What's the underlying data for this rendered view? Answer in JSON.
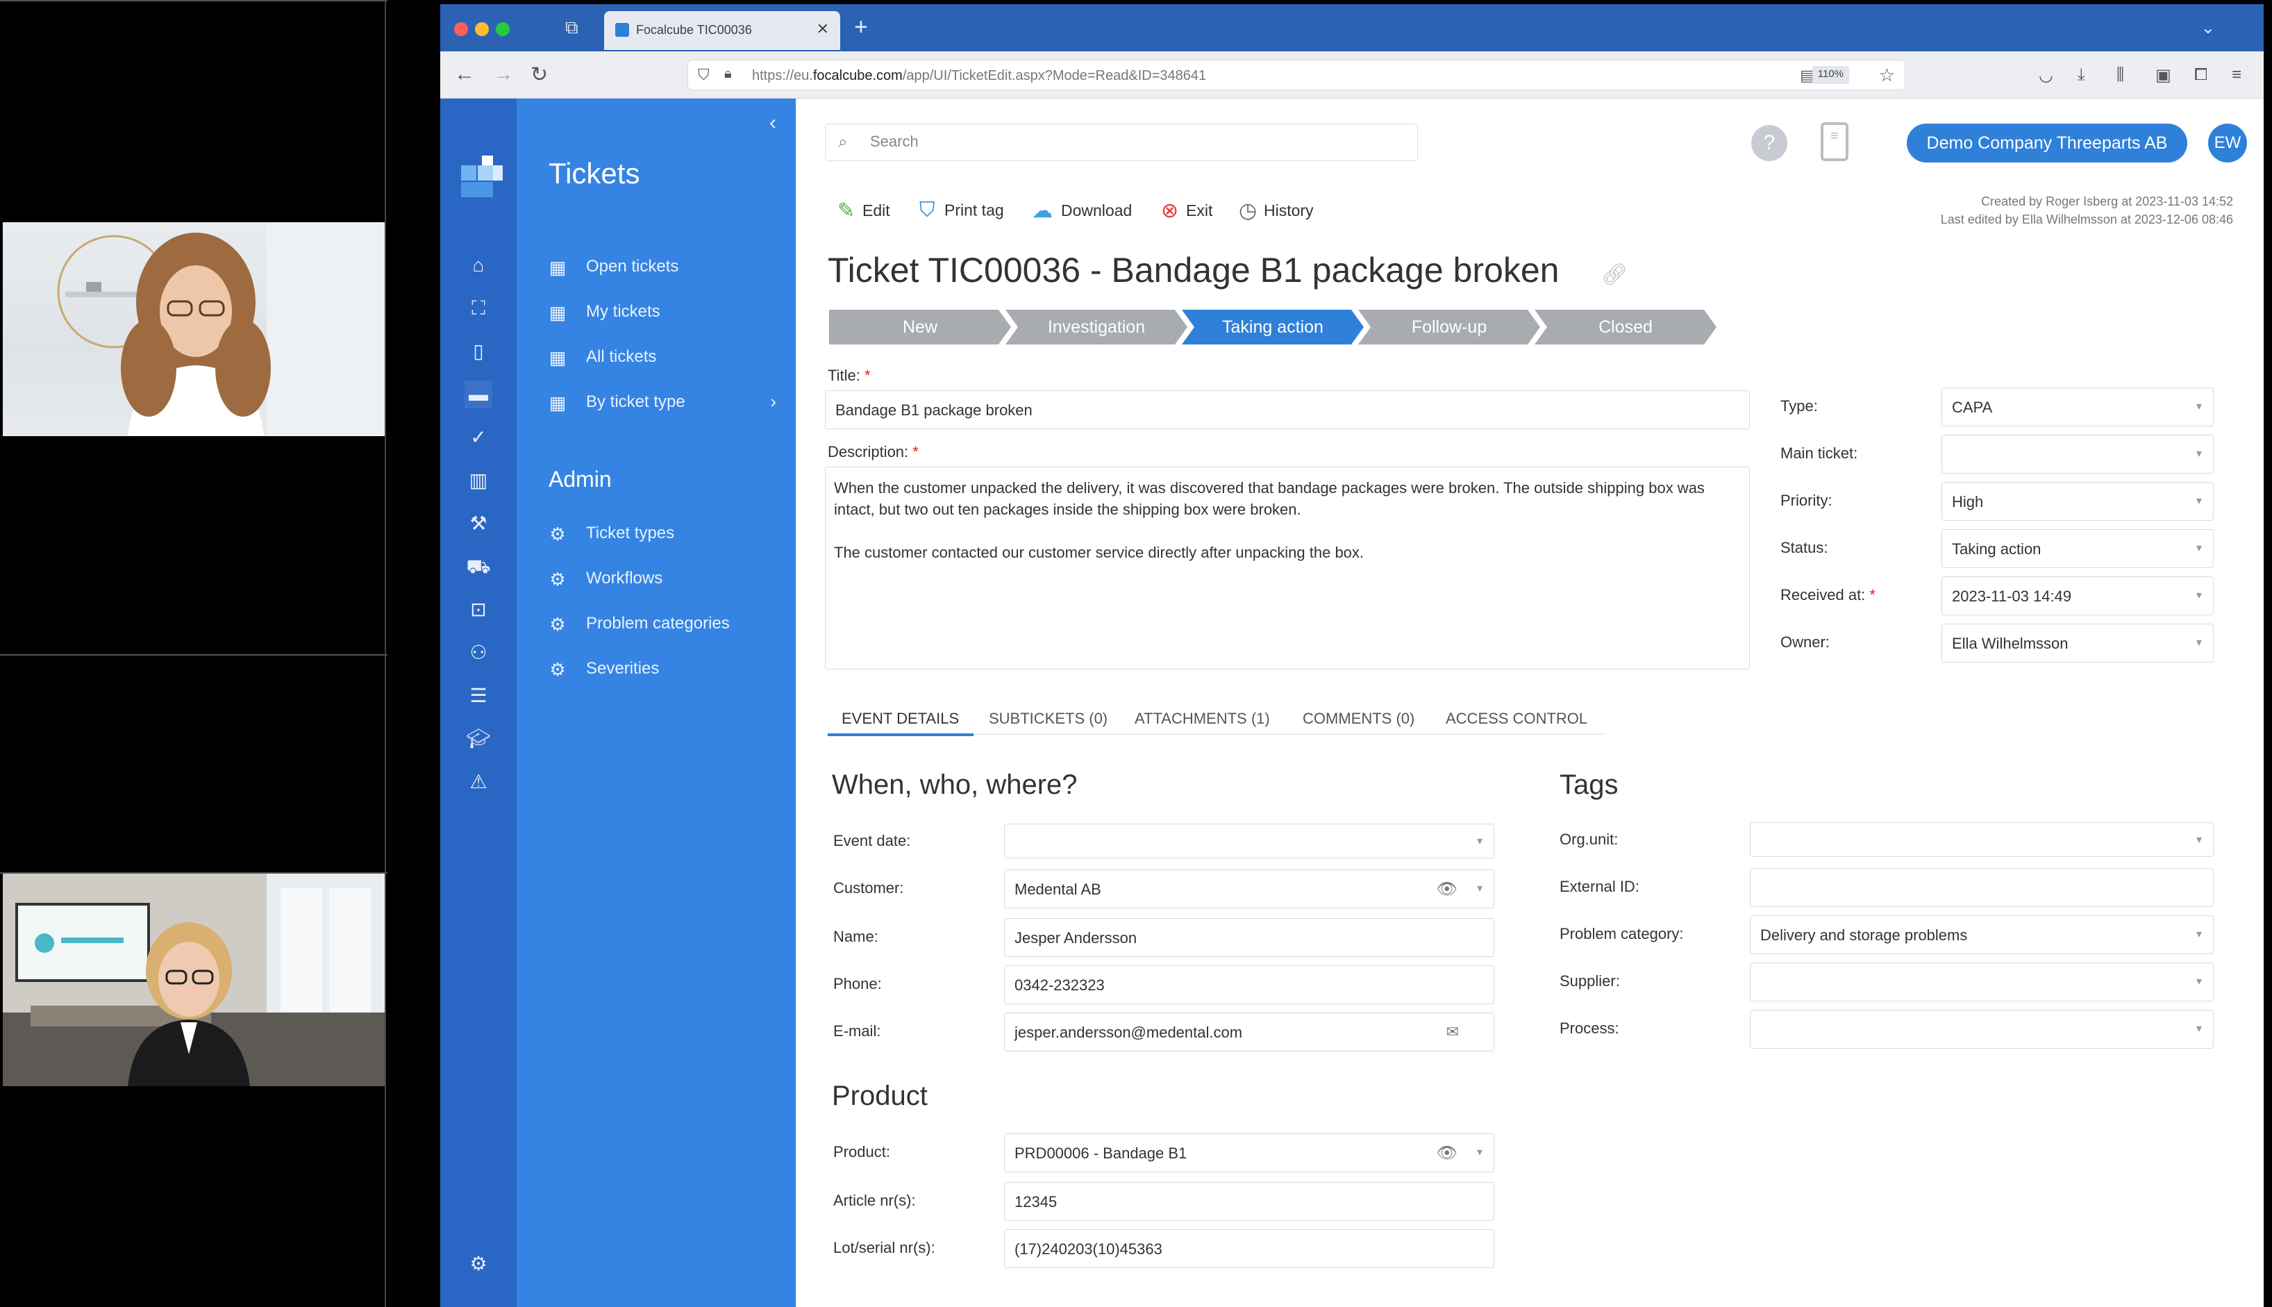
{
  "browser": {
    "tab_title": "Focalcube TIC00036",
    "url_prefix": "https://eu.",
    "url_domain": "focalcube.com",
    "url_rest": "/app/UI/TicketEdit.aspx?Mode=Read&ID=348641",
    "zoom": "110%"
  },
  "sidebar": {
    "tickets_title": "Tickets",
    "items": [
      {
        "label": "Open tickets"
      },
      {
        "label": "My tickets"
      },
      {
        "label": "All tickets"
      },
      {
        "label": "By ticket type"
      }
    ],
    "admin_title": "Admin",
    "admin_items": [
      {
        "label": "Ticket types"
      },
      {
        "label": "Workflows"
      },
      {
        "label": "Problem categories"
      },
      {
        "label": "Severities"
      }
    ]
  },
  "header": {
    "search_placeholder": "Search",
    "company": "Demo Company Threeparts AB",
    "avatar": "EW",
    "help": "?"
  },
  "actions": {
    "edit": "Edit",
    "print_tag": "Print tag",
    "download": "Download",
    "exit": "Exit",
    "history": "History"
  },
  "meta": {
    "created": "Created by Roger Isberg at 2023-11-03 14:52",
    "edited": "Last edited by Ella Wilhelmsson at 2023-12-06 08:46"
  },
  "ticket": {
    "heading": "Ticket  TIC00036  - Bandage B1 package broken",
    "steps": [
      {
        "label": "New",
        "state": "done"
      },
      {
        "label": "Investigation",
        "state": "done"
      },
      {
        "label": "Taking action",
        "state": "current"
      },
      {
        "label": "Follow-up",
        "state": "todo"
      },
      {
        "label": "Closed",
        "state": "todo"
      }
    ],
    "title_label": "Title:",
    "title_value": "Bandage B1 package broken",
    "description_label": "Description:",
    "description_p1": "When the customer unpacked the delivery, it was discovered that bandage packages were broken. The outside shipping box was intact, but two out ten packages inside the shipping box were broken.",
    "description_p2": "The customer contacted our customer service directly after unpacking the box.",
    "required_mark": "*"
  },
  "properties": {
    "type_label": "Type:",
    "type_value": "CAPA",
    "main_ticket_label": "Main ticket:",
    "main_ticket_value": "",
    "priority_label": "Priority:",
    "priority_value": "High",
    "status_label": "Status:",
    "status_value": "Taking action",
    "received_label": "Received at:",
    "received_value": "2023-11-03 14:49",
    "owner_label": "Owner:",
    "owner_value": "Ella Wilhelmsson"
  },
  "tabs": [
    {
      "label": "EVENT DETAILS"
    },
    {
      "label": "SUBTICKETS (0)"
    },
    {
      "label": "ATTACHMENTS (1)"
    },
    {
      "label": "COMMENTS (0)"
    },
    {
      "label": "ACCESS CONTROL"
    }
  ],
  "event": {
    "heading": "When, who, where?",
    "event_date_label": "Event date:",
    "event_date_value": "",
    "customer_label": "Customer:",
    "customer_value": "Medental AB",
    "name_label": "Name:",
    "name_value": "Jesper Andersson",
    "phone_label": "Phone:",
    "phone_value": "0342-232323",
    "email_label": "E-mail:",
    "email_value": "jesper.andersson@medental.com"
  },
  "tags": {
    "heading": "Tags",
    "orgunit_label": "Org.unit:",
    "orgunit_value": "",
    "external_label": "External ID:",
    "external_value": "",
    "problem_label": "Problem category:",
    "problem_value": "Delivery and storage problems",
    "supplier_label": "Supplier:",
    "supplier_value": "",
    "process_label": "Process:",
    "process_value": ""
  },
  "product": {
    "heading": "Product",
    "product_label": "Product:",
    "product_value": "PRD00006 - Bandage B1",
    "article_label": "Article nr(s):",
    "article_value": "12345",
    "lot_label": "Lot/serial nr(s):",
    "lot_value": "(17)240203(10)45363"
  },
  "colors": {
    "accent": "#2f80d9",
    "sidebar": "#3584e3",
    "rail": "#2a66c4",
    "step_done": "#a8abb0",
    "step_current": "#2f80d9"
  }
}
